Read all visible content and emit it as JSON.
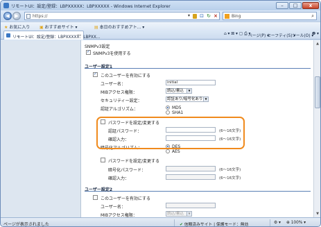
{
  "window": {
    "title": "リモートUI：設定/登録：LBPXXXXX：LBPXXXXX - Windows Internet Explorer",
    "minimize": "–",
    "maximize": "□",
    "close": "x"
  },
  "address": {
    "url": "https://",
    "search_engine": "Bing"
  },
  "favorites": {
    "favorites_label": "お気に入り",
    "suggested_label": "おすすめサイト ▾",
    "today_label": "本日のおすすめアト... ▾"
  },
  "tab": {
    "label": "リモートUI：設定/登録：LBPXXXXX：LBPXX...",
    "commands": {
      "page": "ページ(P) ▾",
      "safety": "セーフティ(S) ▾",
      "tools": "ツール(O) ▾",
      "help": "❷ ▾"
    }
  },
  "content": {
    "snmpv3_header": "SNMPv3設定",
    "snmpv3_enable": "SNMPv3を使用する",
    "user1": {
      "header": "ユーザー設定1",
      "enable_label": "このユーザーを有効にする",
      "username_label": "ユーザー名：",
      "username_value": "initial",
      "mib_access_label": "MIBアクセス権限：",
      "mib_access_value": "読込/書込",
      "security_label": "セキュリティー設定：",
      "security_value": "認証あり/暗号化あり",
      "auth_algo_label": "認証アルゴリズム：",
      "auth_md5": "MD5",
      "auth_sha1": "SHA1",
      "set_auth_password_label": "パスワードを設定/変更する",
      "auth_password_label": "認証パスワード：",
      "auth_password_hint": "(6～16文字)",
      "confirm_label": "確認入力：",
      "confirm_hint": "(6～16文字)",
      "encrypt_algo_label": "暗号化アルゴリズム：",
      "enc_des": "DES",
      "enc_aes": "AES",
      "set_enc_password_label": "パスワードを設定/変更する",
      "enc_password_label": "暗号化パスワード：",
      "enc_password_hint": "(6～16文字)",
      "enc_confirm_label": "確認入力：",
      "enc_confirm_hint": "(6～16文字)"
    },
    "user2": {
      "header": "ユーザー設定2",
      "enable_label": "このユーザーを有効にする",
      "username_label": "ユーザー名：",
      "mib_access_label": "MIBアクセス権限：",
      "mib_access_value": "読込/書込"
    }
  },
  "status": {
    "text": "ページが表示されました",
    "zone": "信頼済みサイト | 保護モード：無効",
    "zoom": "100%"
  },
  "colors": {
    "highlight": "#f08a1c",
    "section_rule": "#5a7fb5"
  }
}
